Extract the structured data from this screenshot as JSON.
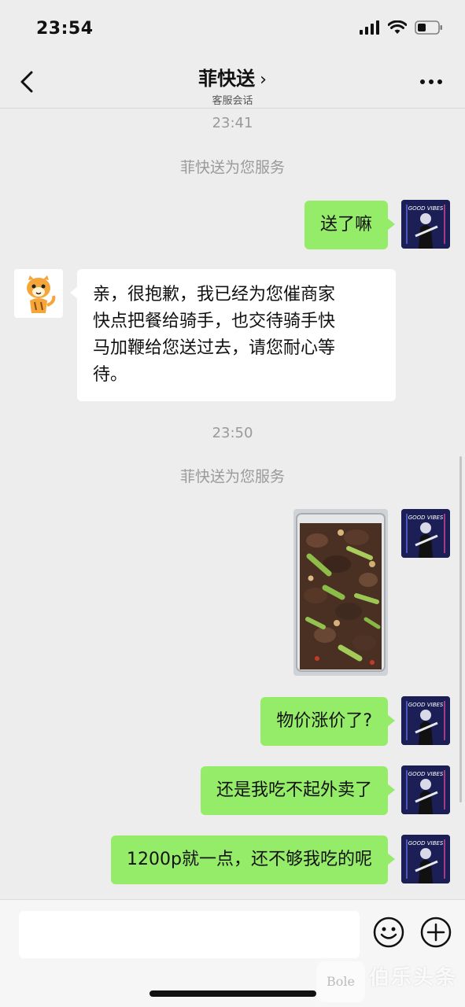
{
  "status_bar": {
    "time": "23:54"
  },
  "header": {
    "title": "菲快送",
    "chevron": "›",
    "subtitle": "客服会话"
  },
  "messages": {
    "time1": "23:41",
    "system1": "菲快送为您服务",
    "m1": "送了嘛",
    "m2_lines": [
      "亲，很抱歉，我已经为您催商家",
      "快点把餐给骑手，也交待骑手快",
      "马加鞭给您送过去，请您耐心等",
      "待。"
    ],
    "time2": "23:50",
    "system2": "菲快送为您服务",
    "m4": "物价涨价了?",
    "m5": "还是我吃不起外卖了",
    "m6": "1200p就一点，还不够我吃的呢"
  },
  "avatars": {
    "user_text": "GOOD VIBES"
  },
  "watermark": {
    "text": "伯乐头条",
    "logo": "Bole"
  },
  "colors": {
    "sent_bubble": "#95ec69",
    "received_bubble": "#ffffff",
    "background": "#ededed"
  },
  "icons": [
    "back-icon",
    "more-icon",
    "emoji-icon",
    "plus-icon",
    "signal-icon",
    "wifi-icon",
    "battery-icon"
  ]
}
